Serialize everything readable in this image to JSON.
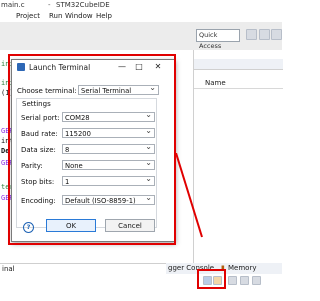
{
  "window": {
    "file_tab": "main.c",
    "app_title": "STM32CubeIDE"
  },
  "menu": {
    "items": [
      "Project",
      "Run",
      "Window",
      "Help"
    ]
  },
  "toolbar": {
    "quick_access": "Quick Access"
  },
  "editor": {
    "lines": [
      "",
      "",
      "",
      "",
      "",
      "",
      "",
      "",
      "",
      "",
      "",
      "",
      "",
      "",
      "",
      "",
      "",
      "",
      ""
    ],
    "visible_fragments": [
      "init",
      "init",
      "(1)",
      "GER",
      "intl",
      "De",
      "GER",
      "ter",
      "GER"
    ]
  },
  "variables_panel": {
    "column_name": "Name"
  },
  "bottom_panel": {
    "left_tab": "inal",
    "tabs": [
      "gger Console",
      "Memory"
    ]
  },
  "dialog": {
    "title": "Launch Terminal",
    "choose_terminal_label": "Choose terminal:",
    "choose_terminal_value": "Serial Terminal",
    "settings_label": "Settings",
    "fields": [
      {
        "label": "Serial port:",
        "value": "COM28"
      },
      {
        "label": "Baud rate:",
        "value": "115200"
      },
      {
        "label": "Data size:",
        "value": "8"
      },
      {
        "label": "Parity:",
        "value": "None"
      },
      {
        "label": "Stop bits:",
        "value": "1"
      }
    ],
    "encoding_label": "Encoding:",
    "encoding_value": "Default (ISO-8859-1)",
    "ok_label": "OK",
    "cancel_label": "Cancel",
    "help_icon": "?",
    "window_buttons": {
      "minimize": "—",
      "maximize": "□",
      "close": "✕"
    }
  },
  "colors": {
    "highlight": "#e00000",
    "ok_border": "#2a7ad7"
  }
}
